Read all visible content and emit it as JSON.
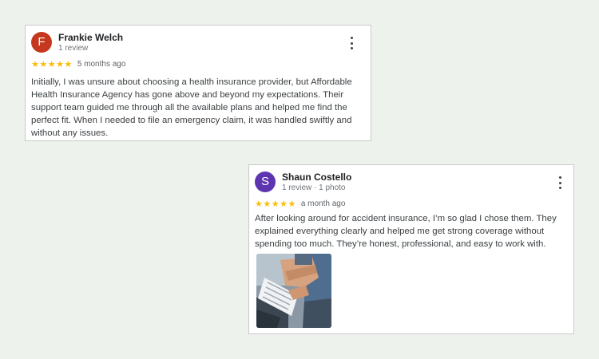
{
  "reviews": [
    {
      "avatar_letter": "F",
      "avatar_color": "#c5381e",
      "name": "Frankie Welch",
      "meta": "1 review",
      "stars": "★★★★★",
      "time": "5 months ago",
      "text": "Initially, I was unsure about choosing a health insurance provider, but Affordable Health Insurance Agency has gone above and beyond my expectations. Their support team guided me through all the available plans and helped me find the perfect fit. When I needed to file an emergency claim, it was handled swiftly and without any issues."
    },
    {
      "avatar_letter": "S",
      "avatar_color": "#5e35b1",
      "name": "Shaun Costello",
      "meta": "1 review · 1 photo",
      "stars": "★★★★★",
      "time": "a month ago",
      "text": "After looking around for accident insurance, I’m so glad I chose them. They explained everything clearly and helped me get strong coverage without spending too much. They’re honest, professional, and easy to work with."
    }
  ],
  "colors": {
    "star": "#fbbc04",
    "page_background": "#eef2ec"
  },
  "icons": {
    "menu": "more-vert-icon"
  }
}
